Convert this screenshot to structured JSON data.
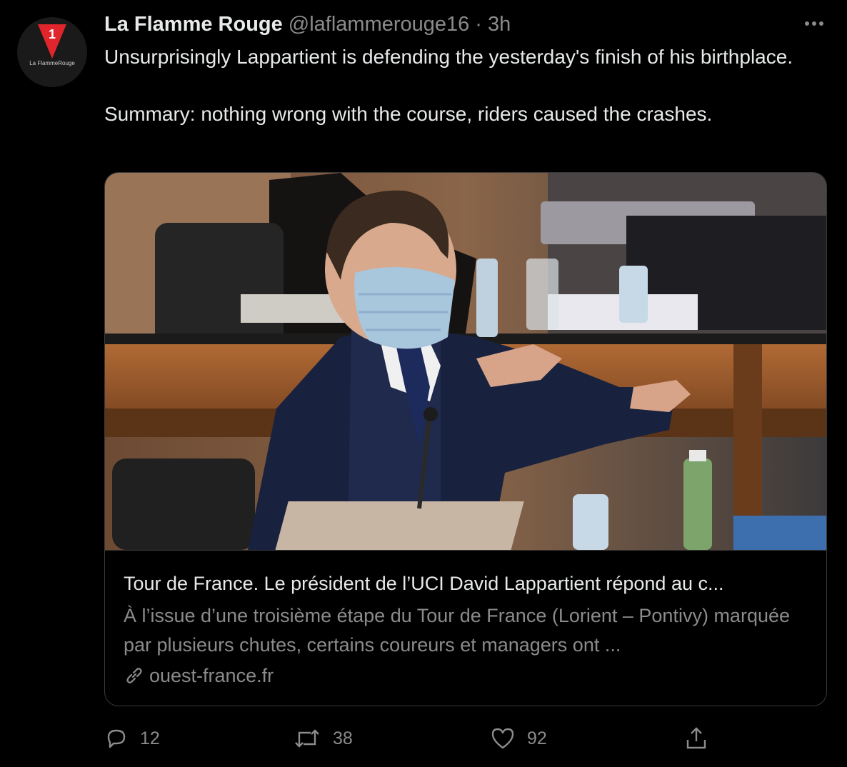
{
  "avatar": {
    "badge_number": "1",
    "caption": "La FlammeRouge"
  },
  "tweet": {
    "display_name": "La Flamme Rouge",
    "handle": "@laflammerouge16",
    "separator": "·",
    "time": "3h",
    "more_icon": "more-icon",
    "text": "Unsurprisingly Lappartient is defending the yesterday's finish of his birthplace.\n\nSummary: nothing wrong with the course, riders caused the crashes."
  },
  "card": {
    "title": "Tour de France. Le président de l’UCI David Lappartient répond au c...",
    "description": "À l’issue d’une troisième étape du Tour de France (Lorient – Pontivy) marquée par plusieurs chutes, certains coureurs et managers ont ...",
    "domain": "ouest-france.fr",
    "link_icon": "link-icon"
  },
  "actions": {
    "reply_count": "12",
    "retweet_count": "38",
    "like_count": "92"
  },
  "colors": {
    "background": "#000000",
    "primary_text": "#e7e9ea",
    "secondary_text": "#8b8b8b",
    "brand_red": "#e0262c"
  }
}
